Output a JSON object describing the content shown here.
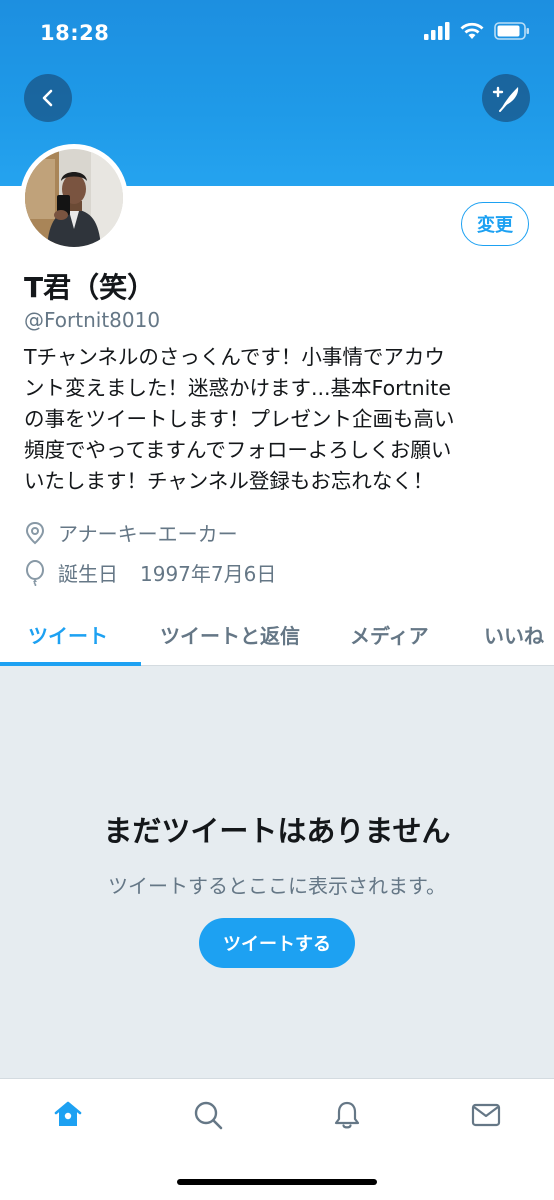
{
  "status_bar": {
    "time": "18:28"
  },
  "profile": {
    "name": "T君（笑）",
    "handle": "@Fortnit8010",
    "bio_lines": [
      "Tチャンネルのさっくんです！小事情でアカウ",
      "ント変えました！迷惑かけます...基本Fortnite",
      "の事をツイートします！プレゼント企画も高い",
      "頻度でやってますんでフォローよろしくお願い",
      "いたします！チャンネル登録もお忘れなく！"
    ],
    "location": "アナーキーエーカー",
    "birth_label": "誕生日",
    "birth_date": "1997年7月6日",
    "edit_label": "変更"
  },
  "tabs": [
    {
      "label": "ツイート",
      "active": true
    },
    {
      "label": "ツイートと返信",
      "active": false
    },
    {
      "label": "メディア",
      "active": false
    },
    {
      "label": "いいね",
      "active": false
    }
  ],
  "empty_state": {
    "title": "まだツイートはありません",
    "subtitle": "ツイートするとここに表示されます。",
    "button_label": "ツイートする"
  },
  "bottom_nav": [
    "home-icon",
    "search-icon",
    "notifications-icon",
    "messages-icon"
  ],
  "colors": {
    "accent": "#1da1f2",
    "header": "#1d8fe0",
    "text_secondary": "#657786",
    "empty_bg": "#e6ecf0"
  }
}
